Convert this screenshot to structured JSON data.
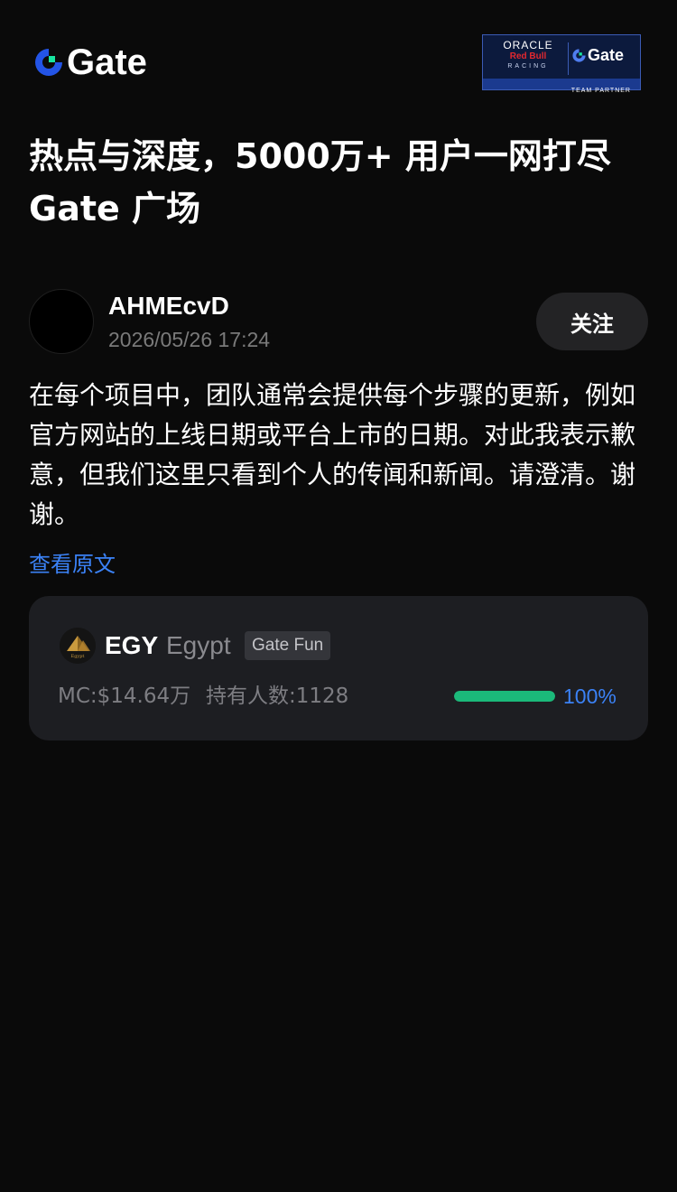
{
  "header": {
    "logo_text": "Gate",
    "partner": {
      "oracle": "ORACLE",
      "redbull": "Red Bull",
      "racing": "RACING",
      "gate_text": "Gate",
      "team_partner": "TEAM PARTNER"
    }
  },
  "headline": "热点与深度，5000万+ 用户一网打尽 Gate 广场",
  "post": {
    "username": "AHMEcvD",
    "timestamp": "2026/05/26 17:24",
    "follow_label": "关注",
    "body": "在每个项目中，团队通常会提供每个步骤的更新，例如官方网站的上线日期或平台上市的日期。对此我表示歉意，但我们这里只看到个人的传闻和新闻。请澄清。谢谢。",
    "translate_label": "查看原文"
  },
  "token_card": {
    "icon": "pyramid-icon",
    "icon_caption": "Egypt",
    "symbol": "EGY",
    "name": "Egypt",
    "tag": "Gate Fun",
    "market_cap": "MC:$14.64万",
    "holders": "持有人数:1128",
    "progress_fraction": 1.0,
    "progress_label": "100%"
  },
  "colors": {
    "background": "#0a0a0a",
    "brand_blue": "#2354e6",
    "brand_accent": "#17e5a0",
    "link": "#3b82f6",
    "progress": "#1bb97a"
  }
}
